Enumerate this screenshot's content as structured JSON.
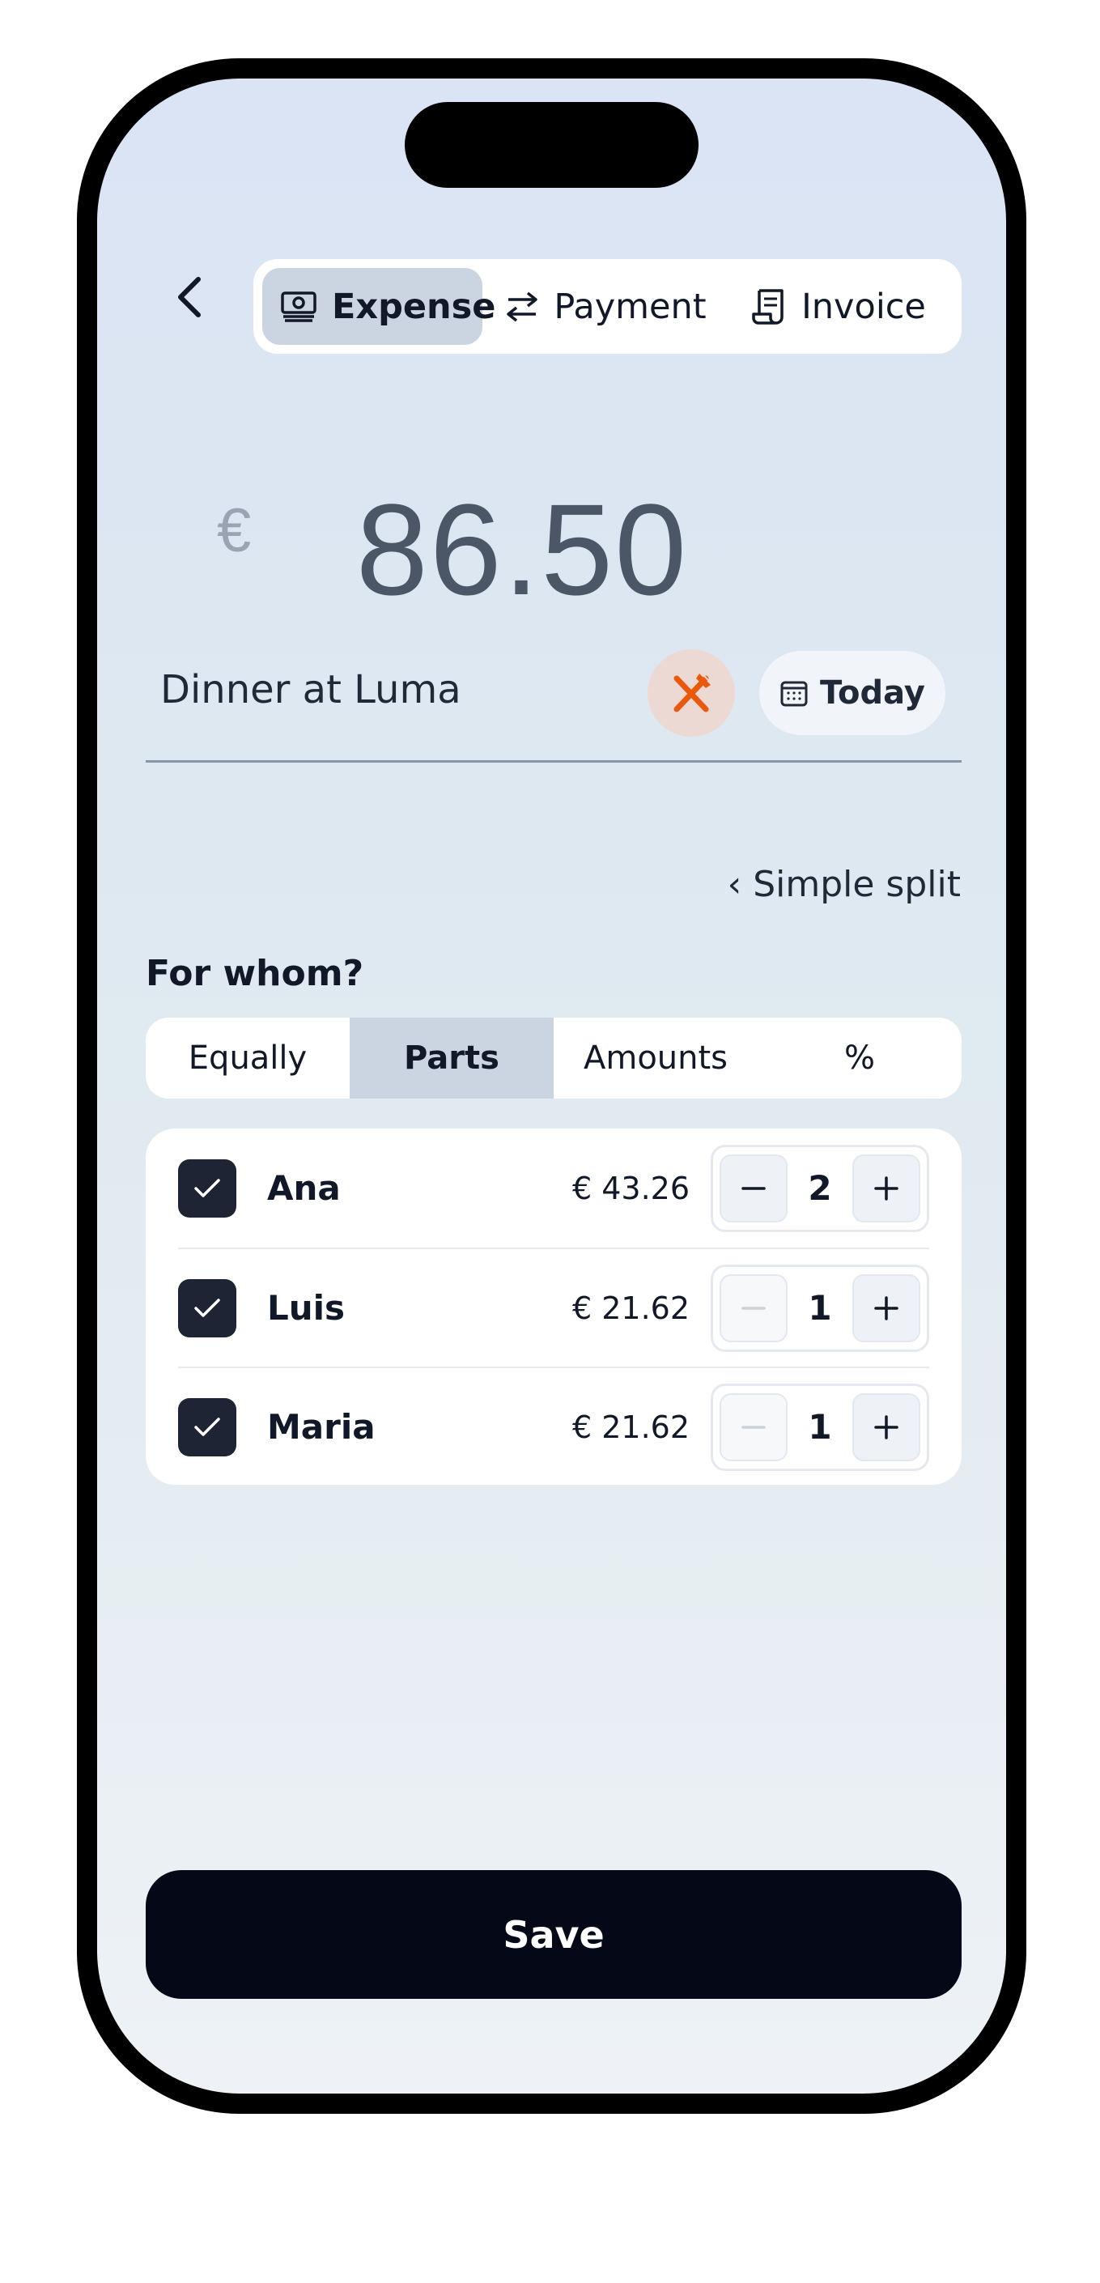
{
  "header": {
    "back_icon": "chevron-left-icon",
    "tabs": [
      {
        "label": "Expense",
        "icon": "banknote-icon",
        "active": true
      },
      {
        "label": "Payment",
        "icon": "arrows-exchange-icon",
        "active": false
      },
      {
        "label": "Invoice",
        "icon": "receipt-icon",
        "active": false
      }
    ]
  },
  "amount": {
    "currency": "€",
    "value": "86.50"
  },
  "description": {
    "value": "Dinner at Luma",
    "category_icon": "fork-knife-icon",
    "category_color": "#ea580c",
    "date_label": "Today",
    "date_icon": "calendar-icon"
  },
  "split": {
    "mode_link": "‹ Simple split",
    "heading": "For whom?",
    "options": [
      "Equally",
      "Parts",
      "Amounts",
      "%"
    ],
    "active_option": "Parts"
  },
  "participants": [
    {
      "name": "Ana",
      "amount": "€ 43.26",
      "parts": "2",
      "checked": true
    },
    {
      "name": "Luis",
      "amount": "€ 21.62",
      "parts": "1",
      "checked": true
    },
    {
      "name": "Maria",
      "amount": "€ 21.62",
      "parts": "1",
      "checked": true
    }
  ],
  "footer": {
    "save_label": "Save"
  },
  "colors": {
    "accent_dark": "#050816",
    "active_segment": "#cbd5e1"
  }
}
